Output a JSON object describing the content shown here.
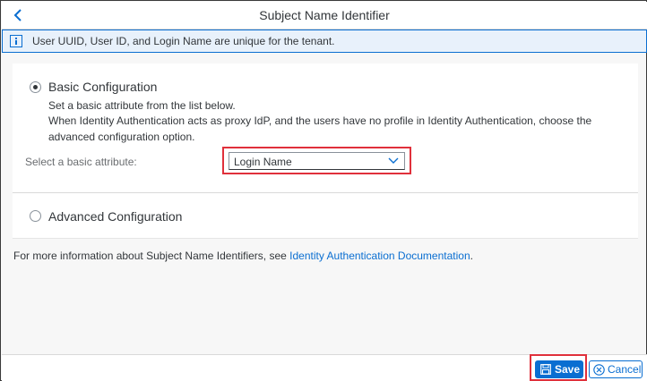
{
  "header": {
    "title": "Subject Name Identifier",
    "back_icon": "chevron-left-icon"
  },
  "info": {
    "icon": "info-icon",
    "text": "User UUID, User ID, and Login Name are unique for the tenant."
  },
  "basic": {
    "label": "Basic Configuration",
    "selected": true,
    "desc1": "Set a basic attribute from the list below.",
    "desc2": "When Identity Authentication acts as proxy IdP, and the users have no profile in Identity Authentication, choose the",
    "desc3": "advanced configuration option.",
    "field_label": "Select a basic attribute:",
    "select_value": "Login Name"
  },
  "advanced": {
    "label": "Advanced Configuration",
    "selected": false
  },
  "more_info": {
    "prefix": "For more information about Subject Name Identifiers, see ",
    "link": "Identity Authentication Documentation",
    "suffix": "."
  },
  "footer": {
    "save_label": "Save",
    "cancel_label": "Cancel"
  },
  "colors": {
    "accent": "#0a6ed1",
    "highlight": "#e0303b",
    "info_bg": "#e8f1fb"
  }
}
